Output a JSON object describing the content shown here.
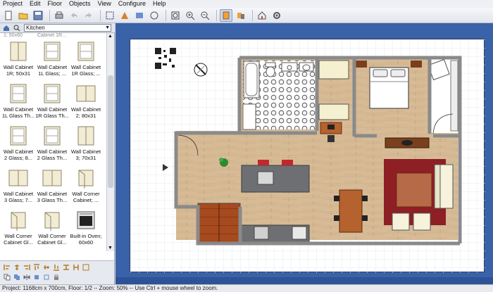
{
  "menu": [
    "Project",
    "Edit",
    "Floor",
    "Objects",
    "View",
    "Configure",
    "Help"
  ],
  "toolbar": {
    "buttons": [
      "new-icon",
      "open-icon",
      "save-icon",
      "print-icon",
      "undo-icon",
      "redo-icon",
      "select-icon",
      "pan-icon",
      "move-icon",
      "rotate-icon",
      "zoom-fit-icon",
      "zoom-in-icon",
      "zoom-out-icon",
      "view-2d-icon",
      "view-3d-icon",
      "house-icon",
      "settings-icon"
    ]
  },
  "catalog": {
    "category": "Kitchen",
    "clipped_row": [
      "1; 50x60",
      "Cabinet 1R...",
      ""
    ],
    "items": [
      {
        "label1": "Wall Cabinet",
        "label2": "1R; 50x31",
        "icon": "wall-cabinet-icon"
      },
      {
        "label1": "Wall Cabinet",
        "label2": "1L Glass; ...",
        "icon": "glass-cabinet-icon"
      },
      {
        "label1": "Wall Cabinet",
        "label2": "1R Glass; ...",
        "icon": "glass-cabinet-icon"
      },
      {
        "label1": "Wall Cabinet",
        "label2": "1L Glass Th...",
        "icon": "glass-cabinet-icon"
      },
      {
        "label1": "Wall Cabinet",
        "label2": "1R Glass Th...",
        "icon": "glass-cabinet-icon"
      },
      {
        "label1": "Wall Cabinet",
        "label2": "2; 80x31",
        "icon": "double-cabinet-icon"
      },
      {
        "label1": "Wall Cabinet",
        "label2": "2 Glass; 8...",
        "icon": "glass-cabinet-icon"
      },
      {
        "label1": "Wall Cabinet",
        "label2": "2 Glass Th...",
        "icon": "glass-cabinet-icon"
      },
      {
        "label1": "Wall Cabinet",
        "label2": "3; 70x31",
        "icon": "wall-cabinet-icon"
      },
      {
        "label1": "Wall Cabinet",
        "label2": "3 Glass; 7...",
        "icon": "double-cabinet-icon"
      },
      {
        "label1": "Wall Cabinet",
        "label2": "3 Glass Th...",
        "icon": "double-cabinet-icon"
      },
      {
        "label1": "Wall Corner",
        "label2": "Cabinet; ...",
        "icon": "corner-cabinet-icon"
      },
      {
        "label1": "Wall Corner",
        "label2": "Cabinet Gl...",
        "icon": "corner-cabinet-icon"
      },
      {
        "label1": "Wall Corner",
        "label2": "Cabinet Gl...",
        "icon": "corner-cabinet-icon"
      },
      {
        "label1": "Built-in Oven;",
        "label2": "60x60",
        "icon": "oven-icon"
      }
    ]
  },
  "status": {
    "text": "Project: 1168cm x 700cm, Floor: 1/2 -- Zoom: 50% -- Use Ctrl + mouse wheel to zoom."
  },
  "colors": {
    "plan_background": "#3a62a8",
    "floor_wood": "#d7bb96",
    "rug": "#8e1f24",
    "stairs": "#a64a1f",
    "wall": "#8a8a8a"
  }
}
